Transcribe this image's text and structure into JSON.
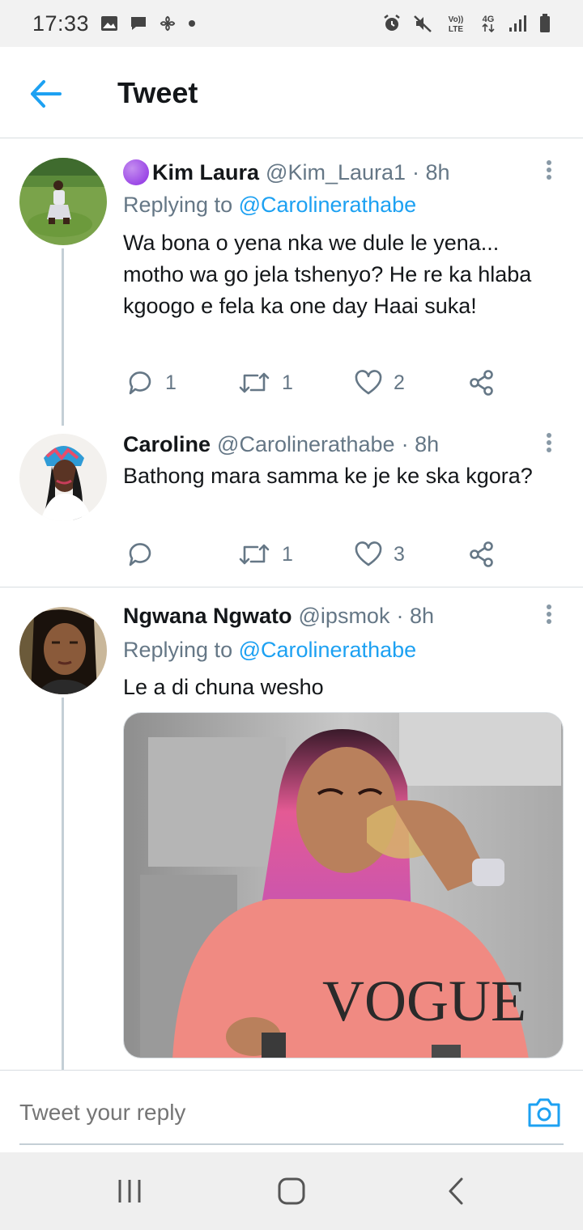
{
  "status_bar": {
    "time": "17:33",
    "left_icons": [
      "image-icon",
      "message-icon",
      "fan-icon",
      "dot-icon"
    ],
    "right_icons": [
      "alarm-icon",
      "mute-icon",
      "volte-icon",
      "4g-icon",
      "signal-icon",
      "battery-icon"
    ],
    "volte_label": "Vo))\nLTE",
    "network_label": "4G"
  },
  "header": {
    "title": "Tweet"
  },
  "tweets": [
    {
      "emoji": "🟣",
      "name": "Kim Laura",
      "handle": "@Kim_Laura1",
      "time": "· 8h",
      "replying_prefix": "Replying to ",
      "replying_to": "@Carolinerathabe",
      "text": "Wa bona o yena nka we dule le yena... motho wa go jela tshenyo? He re ka hlaba kgoogo e fela ka one day Haai suka!",
      "replies": "1",
      "retweets": "1",
      "likes": "2"
    },
    {
      "name": "Caroline",
      "handle": "@Carolinerathabe",
      "time": "· 8h",
      "text": "Bathong mara samma ke je ke ska kgora?",
      "replies": "",
      "retweets": "1",
      "likes": "3"
    },
    {
      "name": "Ngwana Ngwato",
      "handle": "@ipsmok",
      "time": "· 8h",
      "replying_prefix": "Replying to ",
      "replying_to": "@Carolinerathabe",
      "text": "Le a di chuna wesho",
      "media_text": "VOGUE"
    }
  ],
  "reply_bar": {
    "placeholder": "Tweet your reply"
  },
  "colors": {
    "accent": "#1da1f2",
    "secondary_text": "#657786",
    "primary_text": "#14171a",
    "divider": "#d8dde1"
  }
}
